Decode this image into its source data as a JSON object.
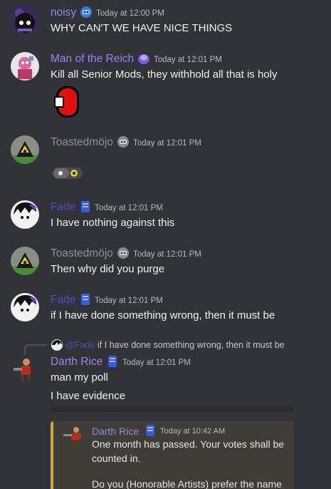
{
  "colors": {
    "background": "#313338",
    "timestamp": "#b5bac1",
    "message_text": "#f2f3f5",
    "name_purple": "#9b84ec",
    "name_gray": "#8e9297",
    "name_fade": "#5a4ab8",
    "embed_accent": "#c9a93a"
  },
  "messages": [
    {
      "author": "noisy",
      "timestamp": "Today at 12:00 PM",
      "text": "WHY CAN'T WE HAVE NICE THINGS",
      "badge_icon": "blue-robot-icon"
    },
    {
      "author": "Man of the Reich",
      "timestamp": "Today at 12:01 PM",
      "text": "Kill all Senior Mods, they withhold all that is holy",
      "badge_icon": "purple-crystal-icon",
      "attachment_icon": "red-ball-sticker-icon"
    },
    {
      "author": "Toastedmöjo",
      "timestamp": "Today at 12:01 PM",
      "badge_icon": "gray-robot-icon",
      "attachment_icon": "toast-emoji-icon"
    },
    {
      "author": "Fade",
      "timestamp": "Today at 12:01 PM",
      "text": "I have nothing against this",
      "badge_icon": "blue-book-icon"
    },
    {
      "author": "Toastedmöjo",
      "timestamp": "Today at 12:01 PM",
      "text": "Then why did you purge",
      "badge_icon": "gray-robot-icon"
    },
    {
      "author": "Fade",
      "timestamp": "Today at 12:01 PM",
      "text": "if I have done something wrong, then it must be",
      "badge_icon": "blue-book-icon"
    },
    {
      "author": "Darth Rice",
      "timestamp": "Today at 12:01 PM",
      "text": "man my poll",
      "text2": "I have evidence",
      "badge_icon": "blue-book-icon",
      "reply": {
        "author": "@Fade",
        "text": "if I have done something wrong, then it must be"
      }
    }
  ],
  "embed": {
    "author": "Darth Rice",
    "timestamp": "Today at 10:42 AM",
    "line1": "One month has passed. Your votes shall be",
    "line2": "counted in.",
    "line3": "Do you (Honorable Artists) prefer the name"
  }
}
